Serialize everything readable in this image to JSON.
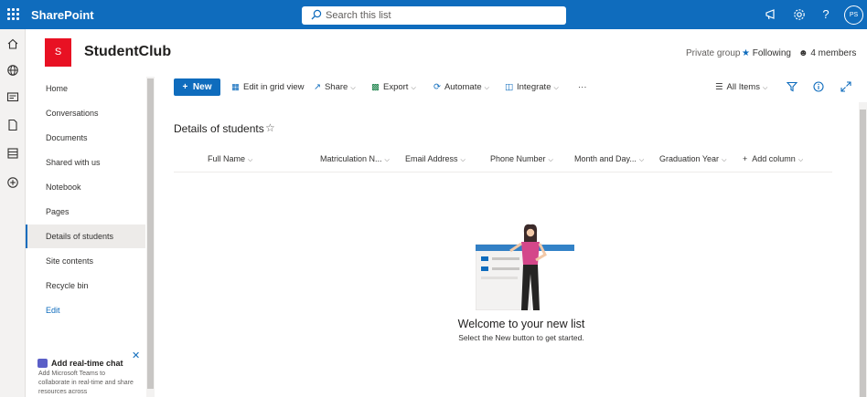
{
  "topbar": {
    "brand": "SharePoint",
    "search_placeholder": "Search this list",
    "avatar_initials": "PS",
    "color": "#0f6cbd"
  },
  "site": {
    "logo_letter": "S",
    "logo_color": "#e81123",
    "name": "StudentClub",
    "privacy": "Private group",
    "following": "Following",
    "members": "4 members"
  },
  "nav": {
    "items": [
      {
        "label": "Home"
      },
      {
        "label": "Conversations"
      },
      {
        "label": "Documents"
      },
      {
        "label": "Shared with us"
      },
      {
        "label": "Notebook"
      },
      {
        "label": "Pages"
      },
      {
        "label": "Details of students",
        "selected": true
      },
      {
        "label": "Site contents"
      },
      {
        "label": "Recycle bin"
      },
      {
        "label": "Edit"
      }
    ]
  },
  "chat": {
    "title": "Add real-time chat",
    "body": "Add Microsoft Teams to collaborate in real-time and share resources across"
  },
  "commands": {
    "new": "New",
    "edit_grid": "Edit in grid view",
    "share": "Share",
    "export": "Export",
    "automate": "Automate",
    "integrate": "Integrate",
    "more": "···",
    "view": "All Items"
  },
  "list": {
    "title": "Details of students",
    "columns": [
      "Full Name",
      "Matriculation N...",
      "Email Address",
      "Phone Number",
      "Month and Day...",
      "Graduation Year",
      "Add column"
    ]
  },
  "empty": {
    "title": "Welcome to your new list",
    "subtitle": "Select the New button to get started."
  }
}
